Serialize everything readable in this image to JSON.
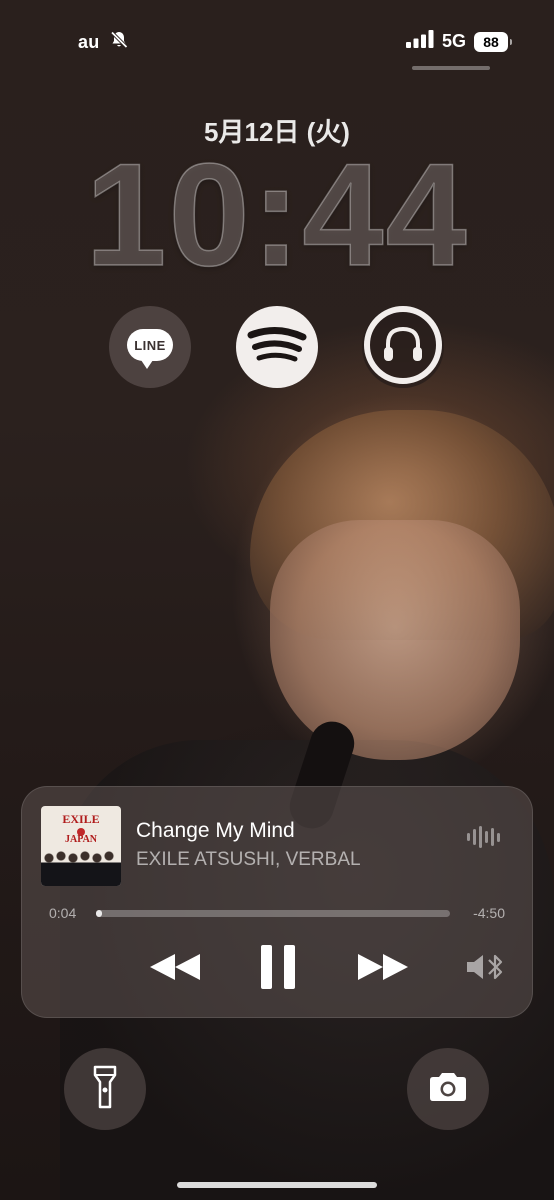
{
  "status_bar": {
    "carrier": "au",
    "network": "5G",
    "battery": "88",
    "icons": [
      "bell-slash-icon",
      "cellular-signal-icon"
    ]
  },
  "lock_screen": {
    "date": "5月12日 (火)",
    "time": "10:44"
  },
  "widgets": [
    {
      "name": "line-widget",
      "label": "LINE",
      "icon": "line-icon"
    },
    {
      "name": "spotify-widget",
      "icon": "spotify-icon"
    },
    {
      "name": "headphones-battery-widget",
      "icon": "headphones-icon"
    }
  ],
  "now_playing": {
    "title": "Change My Mind",
    "artist": "EXILE ATSUSHI, VERBAL",
    "elapsed": "0:04",
    "remaining": "-4:50",
    "progress_fraction": 0.014,
    "album_art": {
      "text_top": "EXILE",
      "text_bottom": "JAPAN"
    },
    "controls": [
      "rewind-icon",
      "pause-icon",
      "fast-forward-icon",
      "bluetooth-speaker-icon"
    ]
  },
  "quick_actions": [
    {
      "name": "flashlight-button",
      "icon": "flashlight-icon"
    },
    {
      "name": "camera-button",
      "icon": "camera-icon"
    }
  ],
  "colors": {
    "spotify_widget_bg": "#f2eeec",
    "card_bg": "rgba(92,82,80,0.55)"
  }
}
